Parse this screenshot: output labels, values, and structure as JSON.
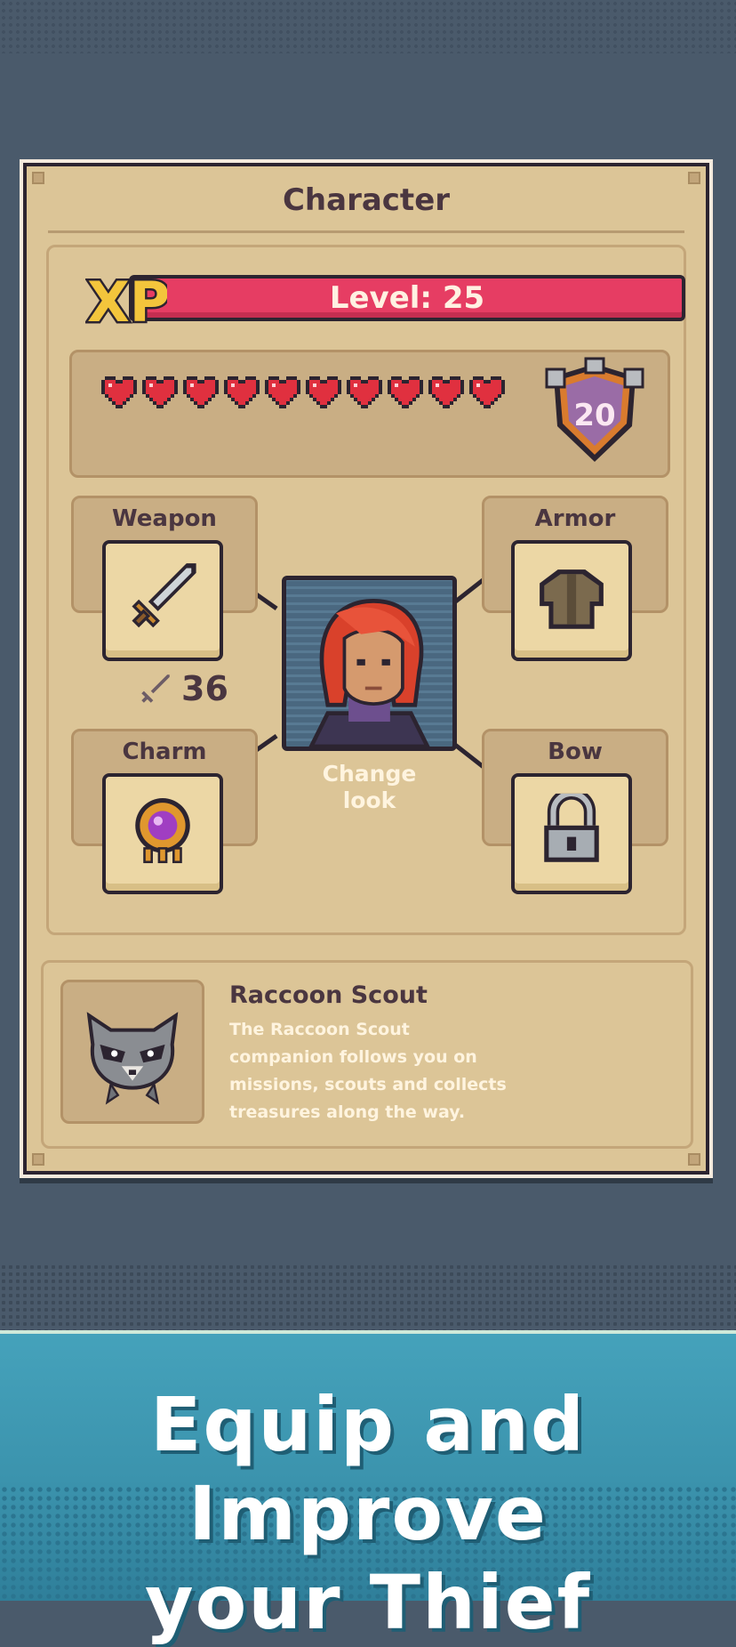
{
  "panel": {
    "title": "Character"
  },
  "xp": {
    "badge": "XP",
    "level_text": "Level: 25"
  },
  "stats": {
    "hearts": 10,
    "armor_value": "20"
  },
  "slots": {
    "weapon": {
      "label": "Weapon",
      "icon": "sword-icon",
      "stat": "36"
    },
    "armor": {
      "label": "Armor",
      "icon": "jacket-icon"
    },
    "charm": {
      "label": "Charm",
      "icon": "amulet-icon"
    },
    "bow": {
      "label": "Bow",
      "icon": "lock-icon"
    }
  },
  "character": {
    "change_look_line1": "Change",
    "change_look_line2": "look"
  },
  "companion": {
    "name": "Raccoon Scout",
    "desc_line1": "The Raccoon Scout",
    "desc_line2": "companion follows you on",
    "desc_line3": "missions, scouts and collects",
    "desc_line4": "treasures along the way."
  },
  "banner": {
    "line1": "Equip and Improve",
    "line2": "your Thief"
  },
  "colors": {
    "background": "#4a5a6b",
    "panel": "#dcc597",
    "xp_bar": "#e63d63",
    "banner": "#3b93ad"
  }
}
